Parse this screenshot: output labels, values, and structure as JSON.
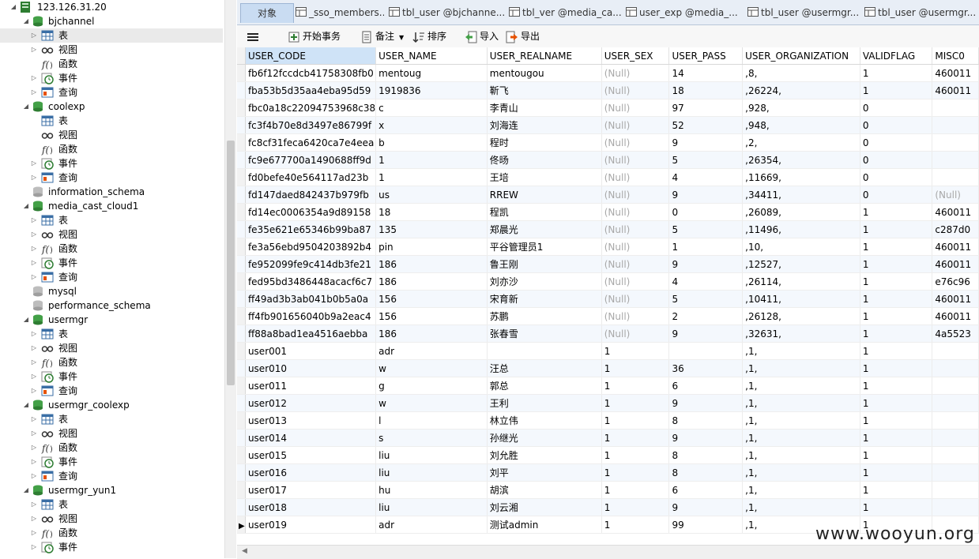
{
  "connection": {
    "label": "123.126.31.20",
    "icon": "server-connection-icon"
  },
  "tree": {
    "db_bjchannel": "bjchannel",
    "db_coolexp": "coolexp",
    "db_information_schema": "information_schema",
    "db_media_cast_cloud1": "media_cast_cloud1",
    "db_mysql": "mysql",
    "db_performance_schema": "performance_schema",
    "db_usermgr": "usermgr",
    "db_usermgr_coolexp": "usermgr_coolexp",
    "db_usermgr_yun1": "usermgr_yun1",
    "tables": "表",
    "views": "视图",
    "functions": "函数",
    "events": "事件",
    "queries": "查询"
  },
  "tabs": [
    {
      "label": "对象"
    },
    {
      "label": "_sso_members..."
    },
    {
      "label": "tbl_user @bjchanne..."
    },
    {
      "label": "tbl_ver @media_ca..."
    },
    {
      "label": "user_exp @media_..."
    },
    {
      "label": "tbl_user @usermgr..."
    },
    {
      "label": "tbl_user @usermgr..."
    }
  ],
  "toolbar": {
    "begin_transaction": "开始事务",
    "memo": "备注",
    "sort": "排序",
    "import": "导入",
    "export": "导出"
  },
  "columns": [
    "USER_CODE",
    "USER_NAME",
    "USER_REALNAME",
    "USER_SEX",
    "USER_PASS",
    "USER_ORGANIZATION",
    "VALIDFLAG",
    "MISC0"
  ],
  "rows": [
    [
      "fb6f12fccdcb41758308fb0",
      "mentoug",
      "mentougou",
      "(Null)",
      "14",
      ",8,",
      "1",
      "460011"
    ],
    [
      "fba53b5d35aa4eba95d59",
      "1919836",
      "靳飞",
      "(Null)",
      "18",
      ",26224,",
      "1",
      "460011"
    ],
    [
      "fbc0a18c22094753968c38",
      "c",
      "李青山",
      "(Null)",
      "97",
      ",928,",
      "0",
      ""
    ],
    [
      "fc3f4b70e8d3497e86799f",
      "x",
      "刘海连",
      "(Null)",
      "52",
      ",948,",
      "0",
      ""
    ],
    [
      "fc8cf31feca6420ca7e4eea",
      "b",
      "程时",
      "(Null)",
      "9",
      ",2,",
      "0",
      ""
    ],
    [
      "fc9e677700a1490688ff9d",
      "1",
      "佟旸",
      "(Null)",
      "5",
      ",26354,",
      "0",
      ""
    ],
    [
      "fd0befe40e564117ad23b",
      "1",
      "王培",
      "(Null)",
      "4",
      ",11669,",
      "0",
      ""
    ],
    [
      "fd147daed842437b979fb",
      "us",
      "RREW",
      "(Null)",
      "9",
      ",34411,",
      "0",
      "(Null)"
    ],
    [
      "fd14ec0006354a9d89158",
      "18",
      "程凯",
      "(Null)",
      "0",
      ",26089,",
      "1",
      "460011"
    ],
    [
      "fe35e621e65346b99ba87",
      "135",
      "郑晨光",
      "(Null)",
      "5",
      ",11496,",
      "1",
      "c287d0"
    ],
    [
      "fe3a56ebd9504203892b4",
      "pin",
      "平谷管理员1",
      "(Null)",
      "1",
      ",10,",
      "1",
      "460011"
    ],
    [
      "fe952099fe9c414db3fe21",
      "186",
      "鲁王刚",
      "(Null)",
      "9",
      ",12527,",
      "1",
      "460011"
    ],
    [
      "fed95bd3486448acacf6c7",
      "186",
      "刘亦沙",
      "(Null)",
      "4",
      ",26114,",
      "1",
      "e76c96"
    ],
    [
      "ff49ad3b3ab041b0b5a0a",
      "156",
      "宋育新",
      "(Null)",
      "5",
      ",10411,",
      "1",
      "460011"
    ],
    [
      "ff4fb901656040b9a2eac4",
      "156",
      "苏鹏",
      "(Null)",
      "2",
      ",26128,",
      "1",
      "460011"
    ],
    [
      "ff88a8bad1ea4516aebba",
      "186",
      "张春雪",
      "(Null)",
      "9",
      ",32631,",
      "1",
      "4a5523"
    ],
    [
      "user001",
      "adr",
      "",
      "1",
      "",
      ",1,",
      "1",
      ""
    ],
    [
      "user010",
      "w",
      "汪总",
      "1",
      "36",
      ",1,",
      "1",
      ""
    ],
    [
      "user011",
      "g",
      "郭总",
      "1",
      "6",
      ",1,",
      "1",
      ""
    ],
    [
      "user012",
      "w",
      "王利",
      "1",
      "9",
      ",1,",
      "1",
      ""
    ],
    [
      "user013",
      "l",
      "林立伟",
      "1",
      "8",
      ",1,",
      "1",
      ""
    ],
    [
      "user014",
      "s",
      "孙继光",
      "1",
      "9",
      ",1,",
      "1",
      ""
    ],
    [
      "user015",
      "liu",
      "刘允胜",
      "1",
      "8",
      ",1,",
      "1",
      ""
    ],
    [
      "user016",
      "liu",
      "刘平",
      "1",
      "8",
      ",1,",
      "1",
      ""
    ],
    [
      "user017",
      "hu",
      "胡滨",
      "1",
      "6",
      ",1,",
      "1",
      ""
    ],
    [
      "user018",
      "liu",
      "刘云湘",
      "1",
      "9",
      ",1,",
      "1",
      ""
    ],
    [
      "user019",
      "adr",
      "测试admin",
      "1",
      "99",
      ",1,",
      "1",
      ""
    ]
  ],
  "watermark": "www.wooyun.org"
}
